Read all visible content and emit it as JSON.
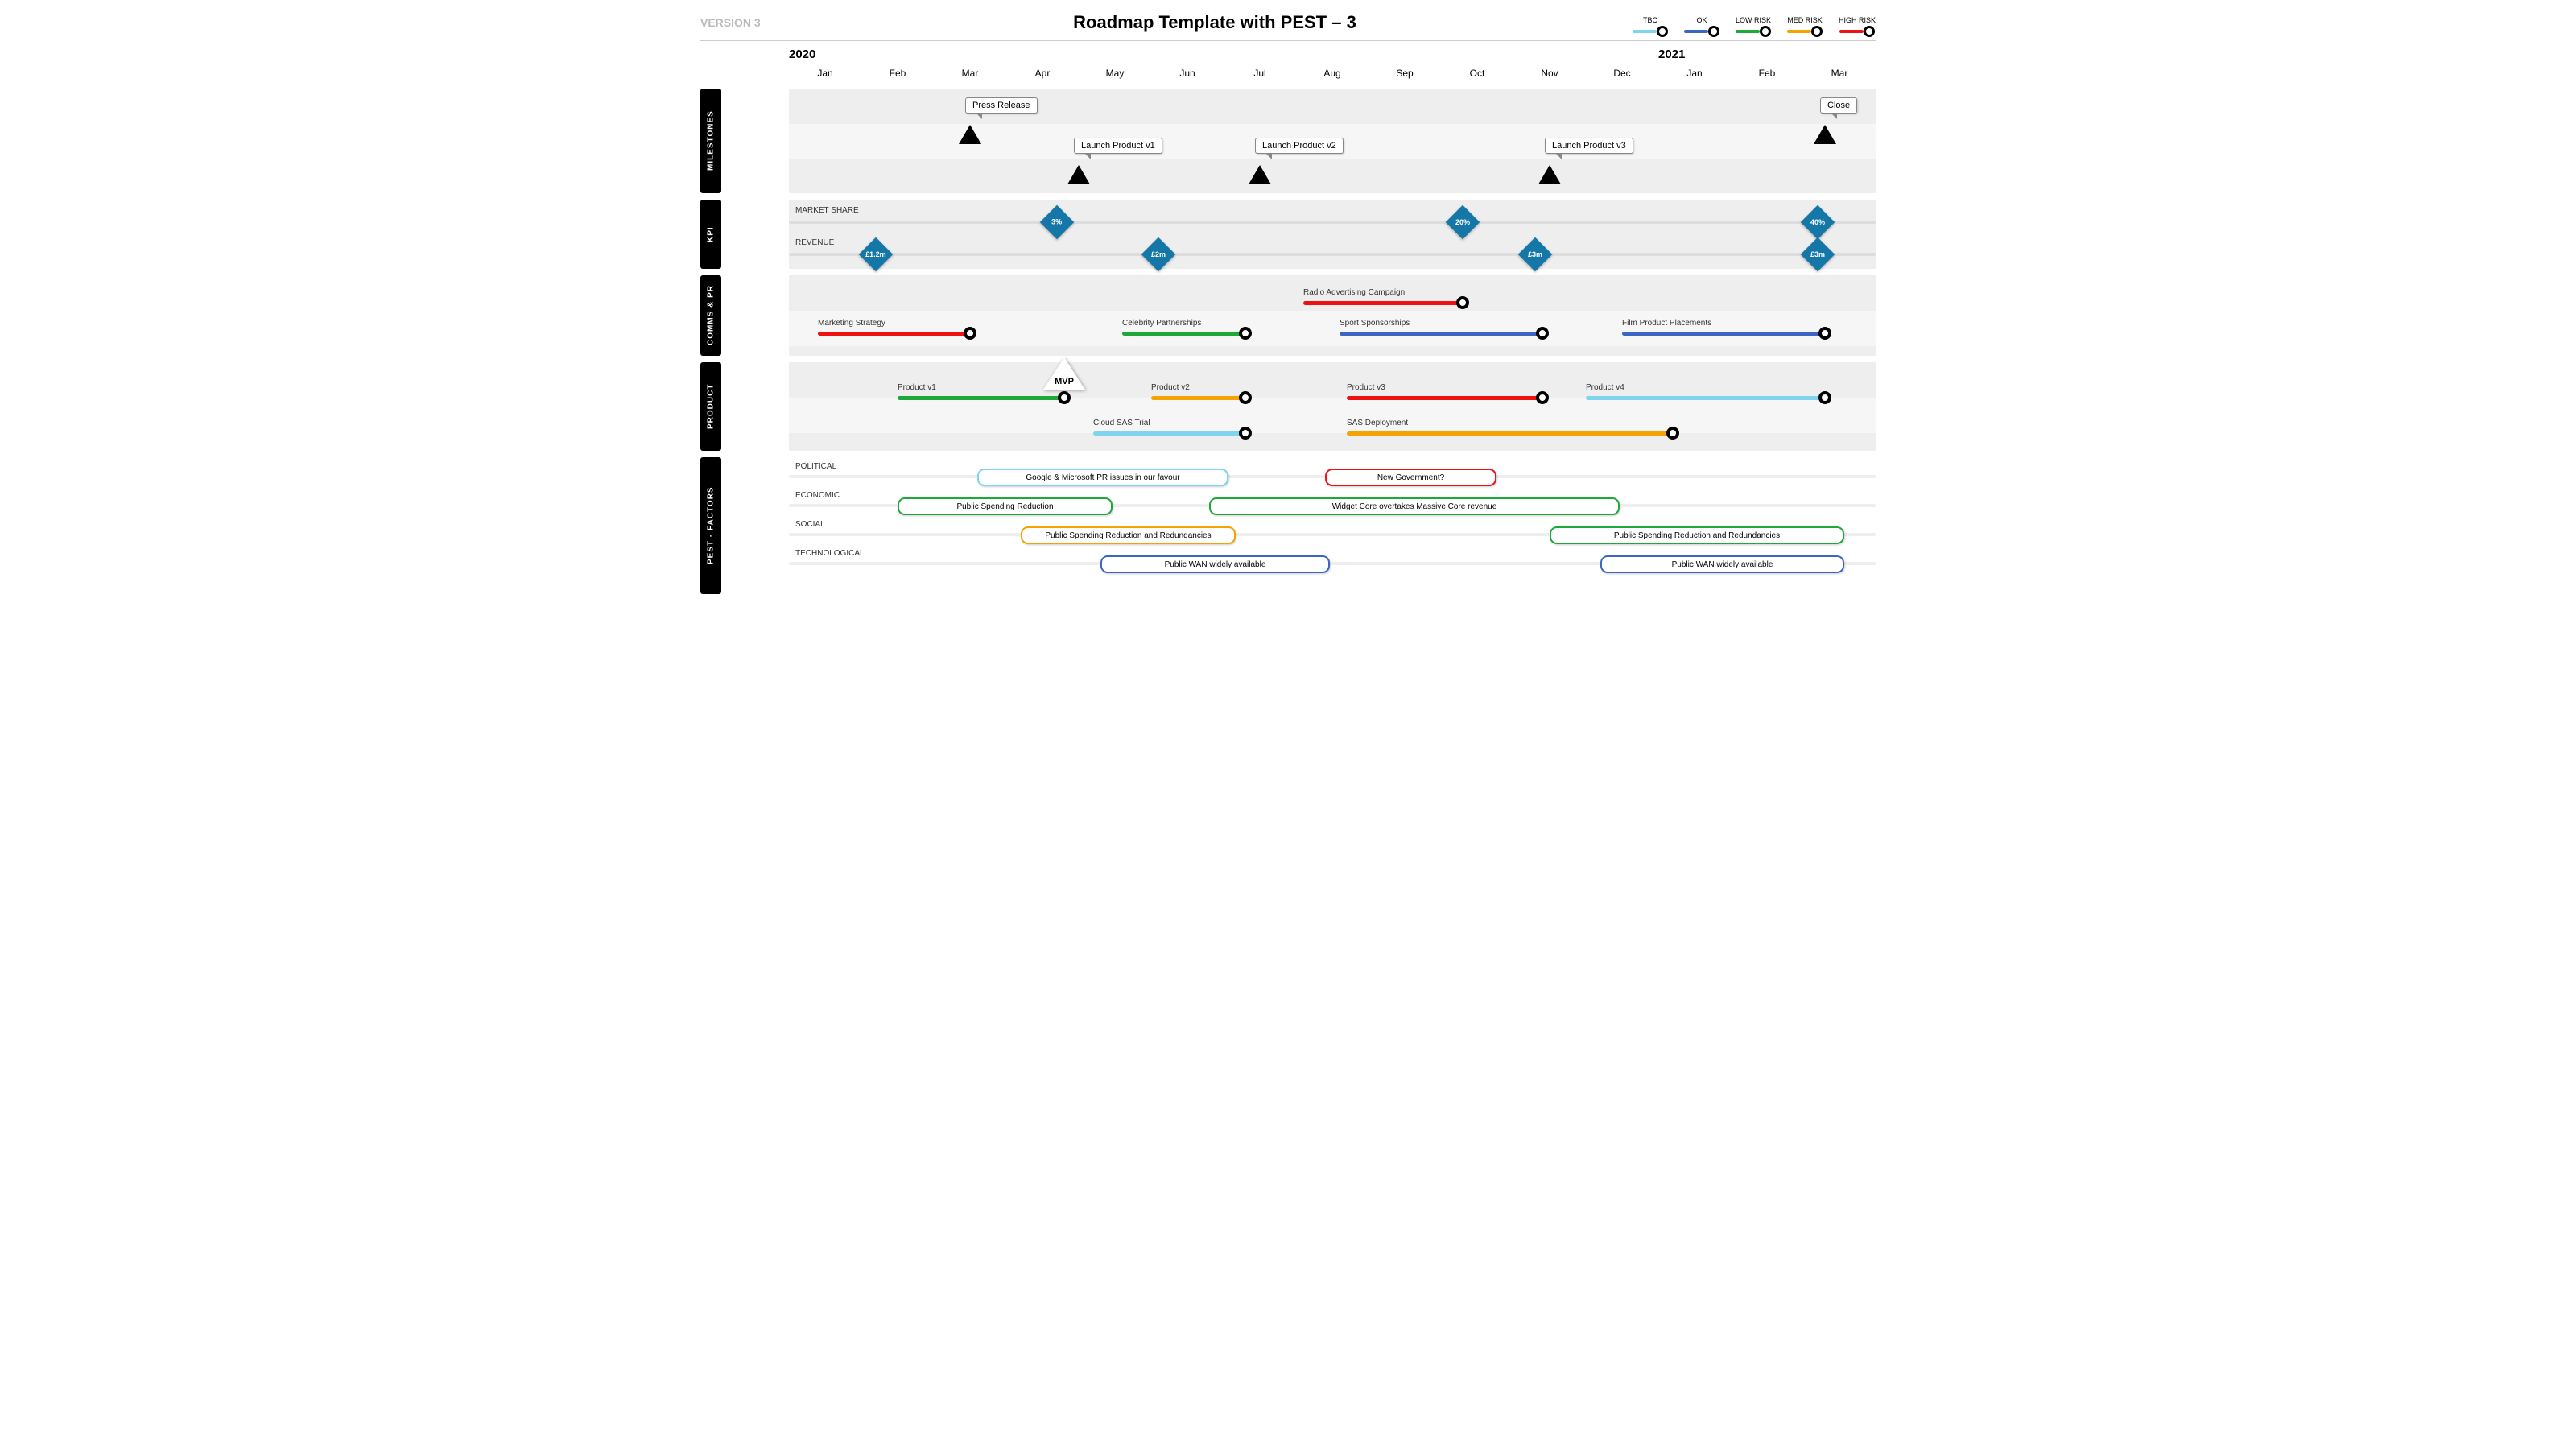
{
  "version": "VERSION 3",
  "title": "Roadmap Template with PEST – 3",
  "legend": {
    "tbc": "TBC",
    "ok": "OK",
    "low": "LOW RISK",
    "med": "MED RISK",
    "high": "HIGH RISK"
  },
  "timeline": {
    "year_a": "2020",
    "year_b": "2021",
    "months": [
      "Jan",
      "Feb",
      "Mar",
      "Apr",
      "May",
      "Jun",
      "Jul",
      "Aug",
      "Sep",
      "Oct",
      "Nov",
      "Dec",
      "Jan",
      "Feb",
      "Mar"
    ]
  },
  "lanes": {
    "milestones": {
      "label": "MILESTONES",
      "items": {
        "press": {
          "label": "Press Release",
          "month": 2.5
        },
        "v1": {
          "label": "Launch Product v1",
          "month": 4
        },
        "v2": {
          "label": "Launch Product v2",
          "month": 6.5
        },
        "v3": {
          "label": "Launch Product v3",
          "month": 10.5
        },
        "close": {
          "label": "Close",
          "month": 14.3
        }
      }
    },
    "kpi": {
      "label": "KPI",
      "rows": {
        "market": "MARKET SHARE",
        "revenue": "REVENUE"
      },
      "market": {
        "m3": "3%",
        "m20": "20%",
        "m40": "40%"
      },
      "revenue": {
        "r12": "£1.2m",
        "r2": "£2m",
        "r3a": "£3m",
        "r3b": "£3m"
      }
    },
    "comms": {
      "label": "COMMS & PR",
      "items": {
        "mkt": {
          "label": "Marketing Strategy",
          "start": 0.4,
          "end": 2.5,
          "risk": "high",
          "row": 1
        },
        "celeb": {
          "label": "Celebrity Partnerships",
          "start": 4.6,
          "end": 6.3,
          "risk": "low",
          "row": 1
        },
        "radio": {
          "label": "Radio Advertising Campaign",
          "start": 7.1,
          "end": 9.3,
          "risk": "high",
          "row": 0
        },
        "sport": {
          "label": "Sport Sponsorships",
          "start": 7.6,
          "end": 10.4,
          "risk": "ok",
          "row": 1
        },
        "film": {
          "label": "Film Product Placements",
          "start": 11.5,
          "end": 14.3,
          "risk": "ok",
          "row": 1
        }
      }
    },
    "product": {
      "label": "PRODUCT",
      "mvp": "MVP",
      "items": {
        "p1": {
          "label": "Product v1",
          "start": 1.5,
          "end": 3.8,
          "risk": "low",
          "row": 0
        },
        "p2": {
          "label": "Product v2",
          "start": 5,
          "end": 6.3,
          "risk": "med",
          "row": 0
        },
        "p3": {
          "label": "Product  v3",
          "start": 7.7,
          "end": 10.4,
          "risk": "high",
          "row": 0
        },
        "p4": {
          "label": "Product  v4",
          "start": 11,
          "end": 14.3,
          "risk": "tbc",
          "row": 0
        },
        "sasT": {
          "label": "Cloud SAS Trial",
          "start": 4.2,
          "end": 6.3,
          "risk": "tbc",
          "row": 1
        },
        "sasD": {
          "label": "SAS Deployment",
          "start": 7.7,
          "end": 12.2,
          "risk": "med",
          "row": 1
        }
      }
    },
    "pest": {
      "label": "PEST - FACTORS",
      "rows": {
        "pol": "POLITICAL",
        "eco": "ECONOMIC",
        "soc": "SOCIAL",
        "tech": "TECHNOLOGICAL"
      },
      "items": {
        "goog": {
          "label": "Google & Microsoft PR issues in our favour",
          "start": 2.6,
          "end": 5.8,
          "risk": "tbc",
          "row": 0
        },
        "gov": {
          "label": "New Government?",
          "start": 7.4,
          "end": 9.5,
          "risk": "high",
          "row": 0
        },
        "psr": {
          "label": "Public Spending Reduction",
          "start": 1.5,
          "end": 4.2,
          "risk": "low",
          "row": 1
        },
        "widget": {
          "label": "Widget Core overtakes Massive Core revenue",
          "start": 5.8,
          "end": 11.2,
          "risk": "low",
          "row": 1
        },
        "psrr1": {
          "label": "Public Spending Reduction and Redundancies",
          "start": 3.2,
          "end": 5.9,
          "risk": "med",
          "row": 2
        },
        "psrr2": {
          "label": "Public Spending Reduction and Redundancies",
          "start": 10.5,
          "end": 14.3,
          "risk": "low",
          "row": 2
        },
        "wan1": {
          "label": "Public WAN widely available",
          "start": 4.3,
          "end": 7.2,
          "risk": "ok",
          "row": 3
        },
        "wan2": {
          "label": "Public WAN widely available",
          "start": 11.2,
          "end": 14.3,
          "risk": "ok",
          "row": 3
        }
      }
    }
  },
  "chart_data": {
    "type": "gantt-roadmap",
    "time_axis": {
      "start": "2020-01",
      "end": "2021-03",
      "unit": "month",
      "count": 15
    },
    "risk_legend": {
      "tbc": "#7fd4ee",
      "ok": "#3b66c4",
      "low": "#1ea838",
      "med": "#f4a300",
      "high": "#e11"
    },
    "swimlanes": [
      {
        "name": "MILESTONES",
        "type": "milestone",
        "items": [
          {
            "label": "Press Release",
            "t": 2.5
          },
          {
            "label": "Launch Product v1",
            "t": 4
          },
          {
            "label": "Launch Product v2",
            "t": 6.5
          },
          {
            "label": "Launch Product v3",
            "t": 10.5
          },
          {
            "label": "Close",
            "t": 14.3
          }
        ]
      },
      {
        "name": "KPI",
        "type": "kpi",
        "rows": [
          {
            "name": "MARKET SHARE",
            "points": [
              {
                "t": 3.7,
                "v": "3%"
              },
              {
                "t": 9.3,
                "v": "20%"
              },
              {
                "t": 14.2,
                "v": "40%"
              }
            ]
          },
          {
            "name": "REVENUE",
            "points": [
              {
                "t": 1.2,
                "v": "£1.2m"
              },
              {
                "t": 5.1,
                "v": "£2m"
              },
              {
                "t": 10.3,
                "v": "£3m"
              },
              {
                "t": 14.2,
                "v": "£3m"
              }
            ]
          }
        ]
      },
      {
        "name": "COMMS & PR",
        "type": "bar",
        "items": [
          {
            "label": "Marketing Strategy",
            "start": 0.4,
            "end": 2.5,
            "risk": "high"
          },
          {
            "label": "Celebrity Partnerships",
            "start": 4.6,
            "end": 6.3,
            "risk": "low"
          },
          {
            "label": "Radio Advertising Campaign",
            "start": 7.1,
            "end": 9.3,
            "risk": "high"
          },
          {
            "label": "Sport Sponsorships",
            "start": 7.6,
            "end": 10.4,
            "risk": "ok"
          },
          {
            "label": "Film Product Placements",
            "start": 11.5,
            "end": 14.3,
            "risk": "ok"
          }
        ]
      },
      {
        "name": "PRODUCT",
        "type": "bar",
        "marker": {
          "label": "MVP",
          "t": 3.8
        },
        "items": [
          {
            "label": "Product v1",
            "start": 1.5,
            "end": 3.8,
            "risk": "low"
          },
          {
            "label": "Product v2",
            "start": 5,
            "end": 6.3,
            "risk": "med"
          },
          {
            "label": "Product v3",
            "start": 7.7,
            "end": 10.4,
            "risk": "high"
          },
          {
            "label": "Product v4",
            "start": 11,
            "end": 14.3,
            "risk": "tbc"
          },
          {
            "label": "Cloud SAS Trial",
            "start": 4.2,
            "end": 6.3,
            "risk": "tbc"
          },
          {
            "label": "SAS Deployment",
            "start": 7.7,
            "end": 12.2,
            "risk": "med"
          }
        ]
      },
      {
        "name": "PEST - FACTORS",
        "type": "pest",
        "rows": [
          "POLITICAL",
          "ECONOMIC",
          "SOCIAL",
          "TECHNOLOGICAL"
        ],
        "items": [
          {
            "row": "POLITICAL",
            "label": "Google & Microsoft PR issues in our favour",
            "start": 2.6,
            "end": 5.8,
            "risk": "tbc"
          },
          {
            "row": "POLITICAL",
            "label": "New Government?",
            "start": 7.4,
            "end": 9.5,
            "risk": "high"
          },
          {
            "row": "ECONOMIC",
            "label": "Public Spending Reduction",
            "start": 1.5,
            "end": 4.2,
            "risk": "low"
          },
          {
            "row": "ECONOMIC",
            "label": "Widget Core overtakes Massive Core revenue",
            "start": 5.8,
            "end": 11.2,
            "risk": "low"
          },
          {
            "row": "SOCIAL",
            "label": "Public Spending Reduction and Redundancies",
            "start": 3.2,
            "end": 5.9,
            "risk": "med"
          },
          {
            "row": "SOCIAL",
            "label": "Public Spending Reduction and Redundancies",
            "start": 10.5,
            "end": 14.3,
            "risk": "low"
          },
          {
            "row": "TECHNOLOGICAL",
            "label": "Public WAN widely available",
            "start": 4.3,
            "end": 7.2,
            "risk": "ok"
          },
          {
            "row": "TECHNOLOGICAL",
            "label": "Public WAN widely available",
            "start": 11.2,
            "end": 14.3,
            "risk": "ok"
          }
        ]
      }
    ]
  }
}
